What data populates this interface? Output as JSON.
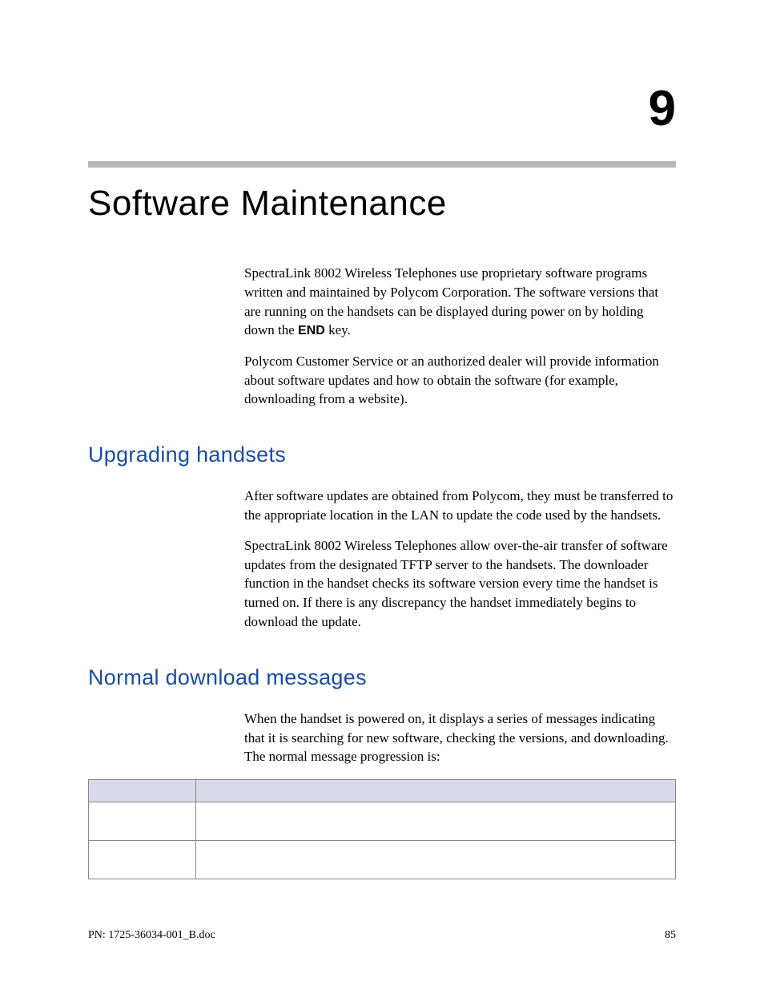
{
  "chapter": {
    "number": "9",
    "title": "Software Maintenance"
  },
  "intro": {
    "p1_a": "SpectraLink 8002 Wireless Telephones use proprietary software programs written and maintained by Polycom Corporation. The software versions that are running on the handsets can be displayed during power on by holding down the ",
    "p1_bold": "END",
    "p1_b": " key.",
    "p2": "Polycom Customer Service or an authorized dealer will provide information about software updates and how to obtain the software (for example, downloading from a website)."
  },
  "section1": {
    "heading": "Upgrading handsets",
    "p1": "After software updates are obtained from Polycom, they must be transferred to the appropriate location in the LAN to update the code used by the handsets.",
    "p2": "SpectraLink 8002 Wireless Telephones allow over-the-air transfer of software updates from the designated TFTP server to the handsets. The downloader function in the handset checks its software version every time the handset is turned on. If there is any discrepancy the handset immediately begins to download the update."
  },
  "section2": {
    "heading": "Normal download messages",
    "p1": "When the handset is powered on, it displays a series of messages indicating that it is searching for new software, checking the versions, and downloading. The normal message progression is:"
  },
  "table": {
    "header1": "",
    "header2": "",
    "rows": [
      {
        "c1": "",
        "c2": ""
      },
      {
        "c1": "",
        "c2": ""
      }
    ]
  },
  "footer": {
    "left": "PN: 1725-36034-001_B.doc",
    "right": "85"
  }
}
